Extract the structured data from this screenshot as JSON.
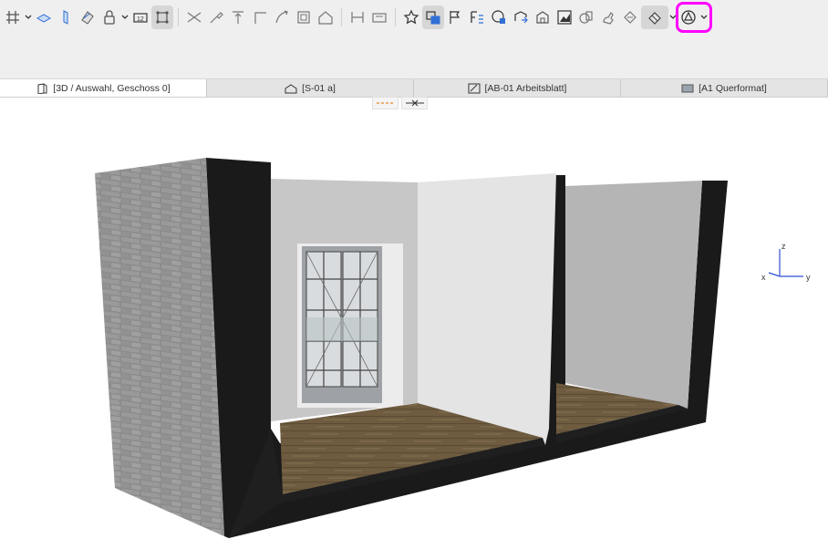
{
  "toolbar": {
    "groups": [
      [
        "grid-icon",
        "slab-icon",
        "column-icon",
        "roof-icon",
        "lock-icon",
        "dimension-icon",
        "node-icon"
      ],
      [
        "trim-icon",
        "adjust-icon",
        "elevate-icon",
        "fillet-icon",
        "curve-icon",
        "offset-icon",
        "house-icon"
      ],
      [
        "stretch-icon",
        "layout-icon"
      ],
      [
        "star-icon",
        "layers-icon",
        "flag-icon",
        "properties-icon",
        "globe-icon",
        "send-icon",
        "building-icon",
        "chart-icon",
        "duplicate-icon",
        "hand-icon",
        "pencil-icon",
        "partial-structure-icon",
        "triangle-circle-icon"
      ]
    ],
    "selected": [
      "node-icon",
      "layers-icon",
      "partial-structure-icon"
    ],
    "highlight_color": "#ff00ff"
  },
  "tabs": [
    {
      "label": "[3D / Auswahl, Geschoss 0]",
      "icon": "cube-icon",
      "active": true
    },
    {
      "label": "[S-01 a]",
      "icon": "section-icon",
      "active": false
    },
    {
      "label": "[AB-01 Arbeitsblatt]",
      "icon": "worksheet-icon",
      "active": false
    },
    {
      "label": "[A1 Querformat]",
      "icon": "layout-sheet-icon",
      "active": false
    }
  ],
  "view_controls": [
    "dashed-line-icon",
    "cutaway-icon"
  ],
  "axes": {
    "z": "z",
    "x": "x",
    "y": "y"
  },
  "colors": {
    "toolbar_bg": "#efefef",
    "accent": "#2f6fd6",
    "wall_black": "#1a1a1a",
    "brick": "#8a8a8a",
    "floor": "#6f5a3e"
  }
}
